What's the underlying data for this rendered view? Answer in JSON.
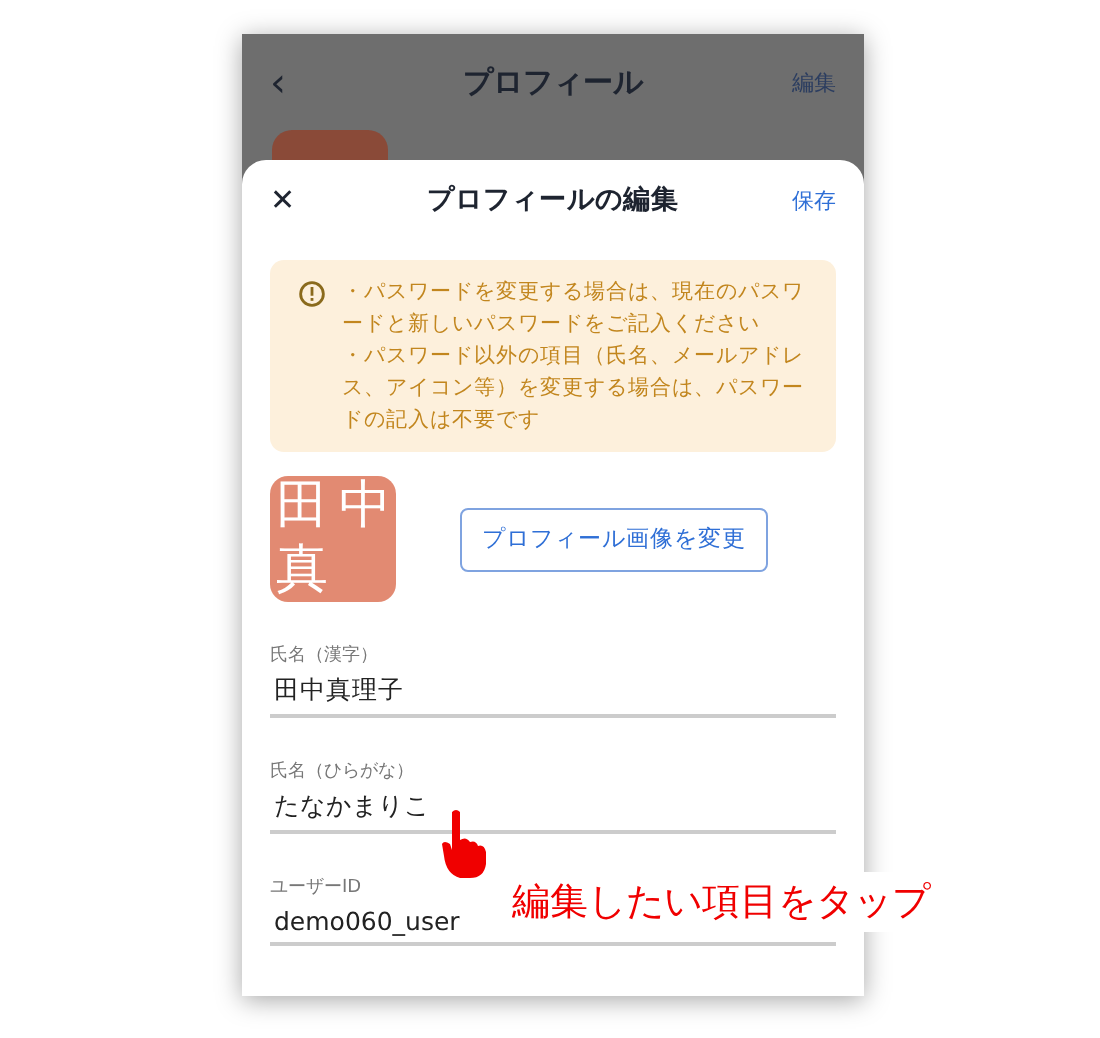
{
  "background_screen": {
    "back": "‹",
    "title": "プロフィール",
    "action": "編集"
  },
  "sheet": {
    "close": "✕",
    "title": "プロフィールの編集",
    "save": "保存"
  },
  "notice": {
    "lines": [
      "・パスワードを変更する場合は、現在のパスワードと新しいパスワードをご記入ください",
      "・パスワード以外の項目（氏名、メールアドレス、アイコン等）を変更する場合は、パスワードの記入は不要です"
    ]
  },
  "avatar": {
    "chars": [
      "田",
      "中",
      "真"
    ],
    "button": "プロフィール画像を変更"
  },
  "fields": [
    {
      "label": "氏名（漢字）",
      "value": "田中真理子"
    },
    {
      "label": "氏名（ひらがな）",
      "value": "たなかまりこ"
    },
    {
      "label": "ユーザーID",
      "value": "demo060_user"
    }
  ],
  "annotation": {
    "text": "編集したい項目をタップ"
  }
}
